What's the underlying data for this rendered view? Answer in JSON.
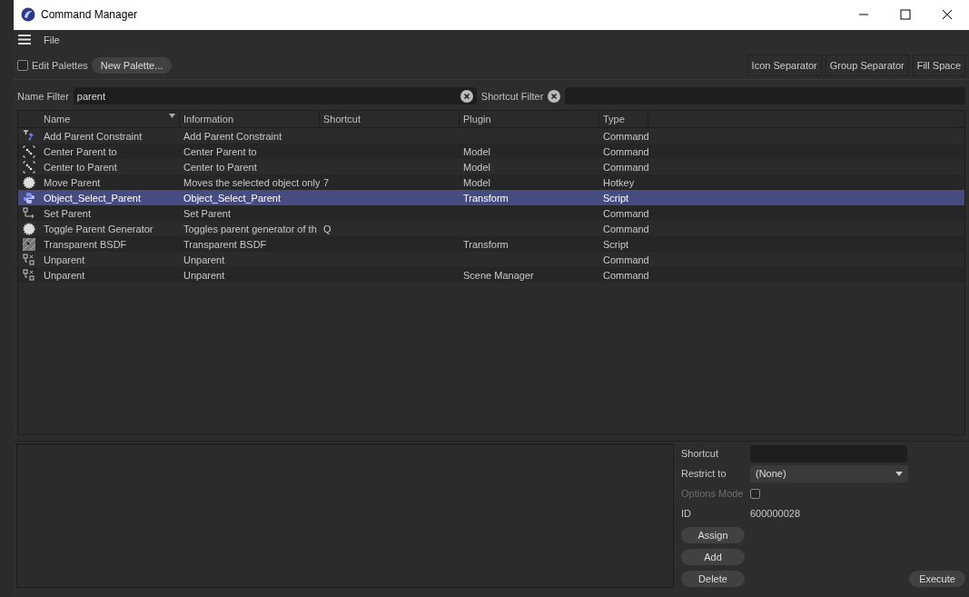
{
  "window": {
    "title": "Command Manager"
  },
  "menu": [
    "File"
  ],
  "toolbar": {
    "edit_palettes": {
      "label": "Edit Palettes",
      "checked": false
    },
    "new_palette": "New Palette...",
    "separators": [
      "Icon Separator",
      "Group Separator",
      "Fill Space"
    ]
  },
  "filters": {
    "name_label": "Name Filter",
    "name_value": "parent",
    "shortcut_label": "Shortcut Filter"
  },
  "table": {
    "columns": [
      "Name",
      "Information",
      "Shortcut",
      "Plugin",
      "Type"
    ],
    "rows": [
      {
        "kind": "constraint",
        "name": "Add Parent Constraint",
        "information": "Add Parent Constraint",
        "shortcut": "",
        "plugin": "",
        "type": "Command",
        "selected": false
      },
      {
        "kind": "center",
        "name": "Center Parent to",
        "information": "Center Parent to",
        "shortcut": "",
        "plugin": "Model",
        "type": "Command",
        "selected": false
      },
      {
        "kind": "center",
        "name": "Center to Parent",
        "information": "Center to Parent",
        "shortcut": "",
        "plugin": "Model",
        "type": "Command",
        "selected": false
      },
      {
        "kind": "gear",
        "name": "Move Parent",
        "information": "Moves the selected object only",
        "shortcut": "7",
        "plugin": "Model",
        "type": "Hotkey",
        "selected": false
      },
      {
        "kind": "python",
        "name": "Object_Select_Parent",
        "information": "Object_Select_Parent",
        "shortcut": "",
        "plugin": "Transform",
        "type": "Script",
        "selected": true
      },
      {
        "kind": "arrow",
        "name": "Set Parent",
        "information": "Set Parent",
        "shortcut": "",
        "plugin": "",
        "type": "Command",
        "selected": false
      },
      {
        "kind": "gear",
        "name": "Toggle Parent Generator",
        "information": "Toggles parent generator of th",
        "shortcut": "Q",
        "plugin": "",
        "type": "Command",
        "selected": false
      },
      {
        "kind": "texture",
        "name": "Transparent BSDF",
        "information": "Transparent BSDF",
        "shortcut": "",
        "plugin": "Transform",
        "type": "Script",
        "selected": false
      },
      {
        "kind": "unparent",
        "name": "Unparent",
        "information": "Unparent",
        "shortcut": "",
        "plugin": "",
        "type": "Command",
        "selected": false
      },
      {
        "kind": "unparent",
        "name": "Unparent",
        "information": "Unparent",
        "shortcut": "",
        "plugin": "Scene Manager",
        "type": "Command",
        "selected": false
      }
    ]
  },
  "details": {
    "shortcut_label": "Shortcut",
    "restrict_label": "Restrict to",
    "restrict_value": "(None)",
    "options_label": "Options Mode",
    "options_checked": false,
    "options_disabled": true,
    "id_label": "ID",
    "id_value": "600000028",
    "buttons": [
      "Assign",
      "Add",
      "Delete"
    ],
    "execute": "Execute"
  }
}
